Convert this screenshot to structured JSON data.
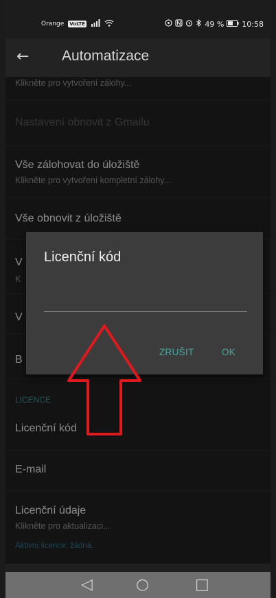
{
  "status": {
    "carrier": "Orange",
    "network": "VoLTE",
    "battery": "49 %",
    "time": "10:58"
  },
  "appbar": {
    "back_icon": "arrow-left-icon",
    "title": "Automatizace"
  },
  "list": {
    "partial_subtitle": "Klikněte pro vytvoření zálohy...",
    "restore_gmail": "Nastavení obnovit z Gmailu",
    "backup_storage": "Vše zálohovat do úložiště",
    "backup_storage_sub": "Klikněte pro vytvoření kompletní zálohy...",
    "restore_storage": "Vše obnovit z úložiště",
    "hidden_item_1_letter": "V",
    "hidden_item_1_sub_letter": "K",
    "hidden_item_2_letter": "V",
    "hidden_item_3_letter": "B",
    "section_licence": "LICENCE",
    "licence_code": "Licenční kód",
    "email": "E-mail",
    "licence_info": "Licenční údaje",
    "licence_info_sub": "Klikněte pro aktualizaci...",
    "active_licence": "Aktivní licence: žádná."
  },
  "dialog": {
    "title": "Licenční kód",
    "input_value": "",
    "cancel": "ZRUŠIT",
    "ok": "OK"
  },
  "colors": {
    "accent": "#4aa7a2",
    "annotation_arrow": "#e0191f"
  }
}
